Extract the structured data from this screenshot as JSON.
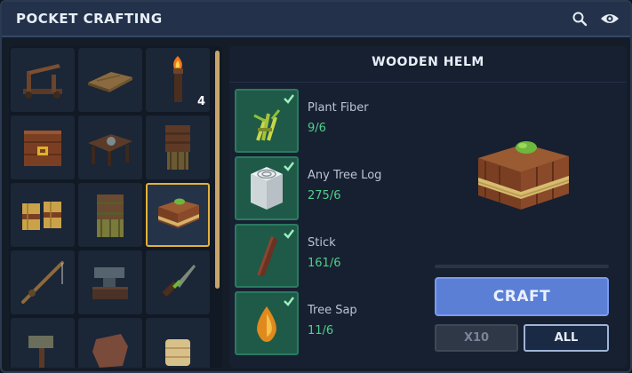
{
  "window": {
    "title": "POCKET CRAFTING",
    "icons": [
      "search-icon",
      "eye-icon"
    ]
  },
  "grid": {
    "items": [
      {
        "name": "catapult",
        "count": ""
      },
      {
        "name": "wooden-plank",
        "count": ""
      },
      {
        "name": "torch",
        "count": "4"
      },
      {
        "name": "wooden-chest",
        "count": ""
      },
      {
        "name": "workbench-table",
        "count": ""
      },
      {
        "name": "wooden-armor",
        "count": ""
      },
      {
        "name": "straw-boots",
        "count": ""
      },
      {
        "name": "grass-armor",
        "count": ""
      },
      {
        "name": "wooden-helm",
        "count": "",
        "selected": true
      },
      {
        "name": "fishing-rod",
        "count": ""
      },
      {
        "name": "anvil",
        "count": ""
      },
      {
        "name": "stone-knife",
        "count": ""
      },
      {
        "name": "stone-hammer",
        "count": ""
      },
      {
        "name": "leather-item",
        "count": ""
      },
      {
        "name": "bandage-roll",
        "count": ""
      }
    ]
  },
  "recipe": {
    "title": "WOODEN HELM",
    "ingredients": [
      {
        "name": "Plant Fiber",
        "qty": "9/6",
        "icon": "plant-fiber-icon"
      },
      {
        "name": "Any Tree Log",
        "qty": "275/6",
        "icon": "tree-log-icon"
      },
      {
        "name": "Stick",
        "qty": "161/6",
        "icon": "stick-icon"
      },
      {
        "name": "Tree Sap",
        "qty": "11/6",
        "icon": "tree-sap-icon"
      }
    ],
    "progress": 0
  },
  "buttons": {
    "craft": "CRAFT",
    "x10": "X10",
    "all": "ALL"
  },
  "colors": {
    "accent": "#5c7fd6",
    "ingredient_ok": "#4fd08a",
    "selected_outline": "#e2b23a"
  }
}
